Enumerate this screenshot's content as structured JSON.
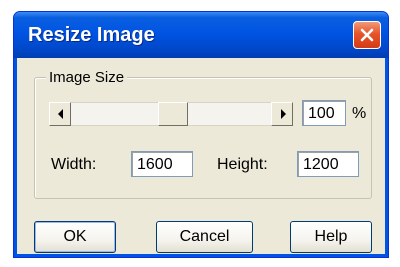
{
  "dialog": {
    "title": "Resize Image",
    "close_icon": "close-icon",
    "title_bar_color": "#0054e3",
    "close_button_color": "#e8542a"
  },
  "image_size": {
    "group_label": "Image Size",
    "scale_percent": "100",
    "percent_symbol": "%",
    "scrollbar": {
      "left_icon": "arrow-left-icon",
      "right_icon": "arrow-right-icon"
    },
    "width_label": "Width:",
    "width_value": "1600",
    "height_label": "Height:",
    "height_value": "1200"
  },
  "buttons": {
    "ok": "OK",
    "cancel": "Cancel",
    "help": "Help"
  }
}
